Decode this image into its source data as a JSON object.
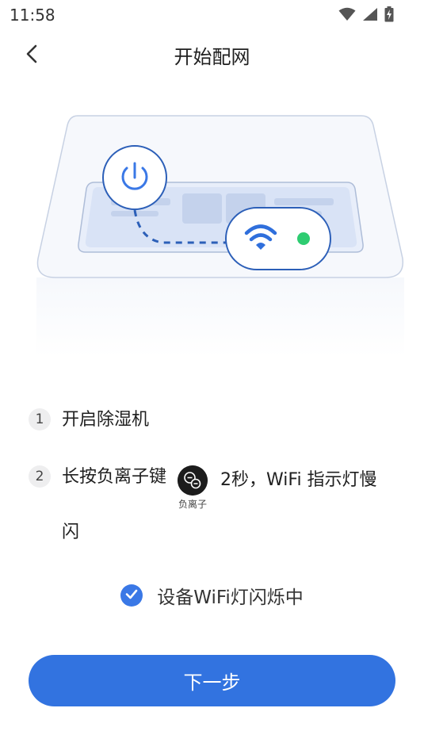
{
  "status_bar": {
    "time": "11:58",
    "icons": [
      "wifi-icon",
      "cellular-signal-icon",
      "battery-charging-icon"
    ]
  },
  "header": {
    "back_icon": "chevron-left-icon",
    "title": "开始配网"
  },
  "illustration": {
    "icons": [
      "power-icon",
      "wifi-icon",
      "status-led-icon"
    ],
    "led_color": "#2ecc71",
    "accent_color": "#3a78e6"
  },
  "steps": [
    {
      "number": "1",
      "text": "开启除湿机"
    },
    {
      "number": "2",
      "text_before": "长按负离子键",
      "button_icon": "negative-ion-button-icon",
      "button_label": "负离子",
      "text_after": "2秒，WiFi 指示灯慢",
      "text_cont": "闪"
    }
  ],
  "confirm": {
    "checked": true,
    "label": "设备WiFi灯闪烁中"
  },
  "next_button": {
    "label": "下一步"
  },
  "colors": {
    "primary": "#3273e0",
    "checkbox": "#3a78e6",
    "text": "#1f1f1f"
  }
}
